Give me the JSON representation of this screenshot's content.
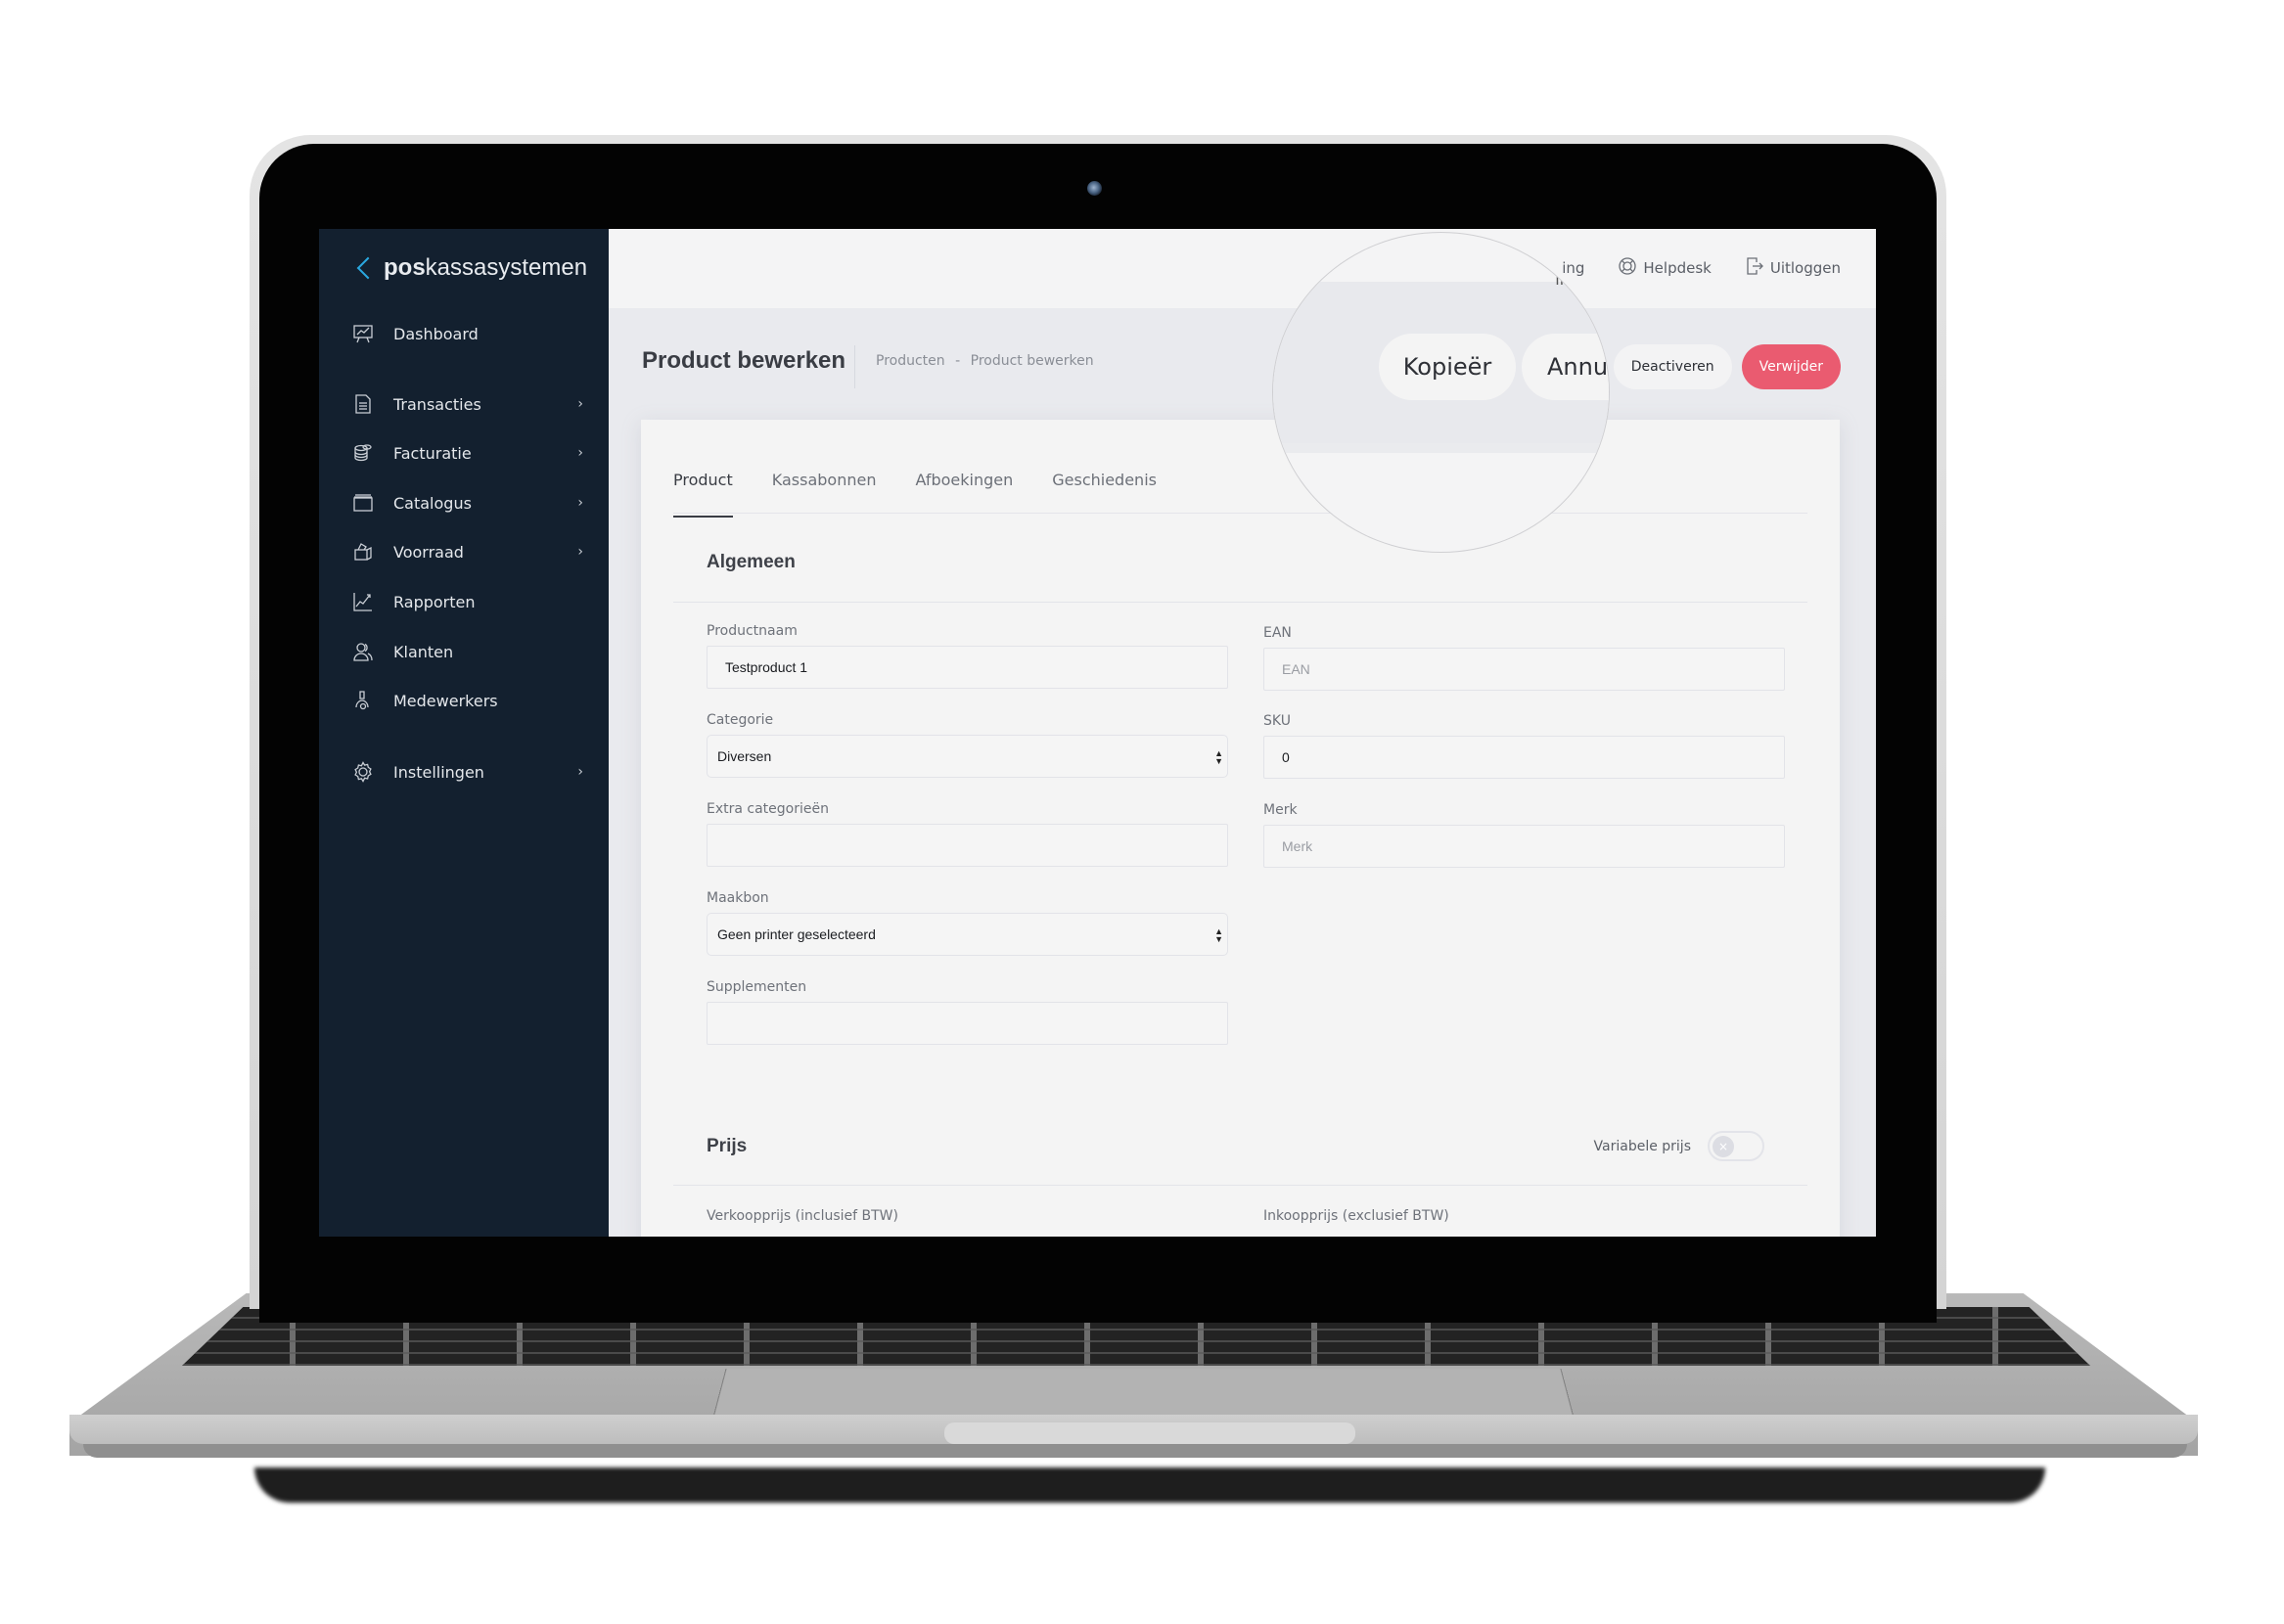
{
  "app": {
    "brand_bold": "pos",
    "brand_rest": "kassasystemen"
  },
  "sidebar": {
    "items": [
      {
        "label": "Dashboard",
        "icon": "presentation-chart-icon",
        "has_submenu": false
      },
      {
        "label": "Transacties",
        "icon": "document-icon",
        "has_submenu": true
      },
      {
        "label": "Facturatie",
        "icon": "coins-icon",
        "has_submenu": true
      },
      {
        "label": "Catalogus",
        "icon": "folder-icon",
        "has_submenu": true
      },
      {
        "label": "Voorraad",
        "icon": "box-icon",
        "has_submenu": true
      },
      {
        "label": "Rapporten",
        "icon": "line-chart-icon",
        "has_submenu": false
      },
      {
        "label": "Klanten",
        "icon": "users-icon",
        "has_submenu": false
      },
      {
        "label": "Medewerkers",
        "icon": "employee-icon",
        "has_submenu": false
      },
      {
        "label": "Instellingen",
        "icon": "gear-icon",
        "has_submenu": true
      }
    ],
    "chevron": "›"
  },
  "topbar": {
    "partial_link": "ing",
    "helpdesk": "Helpdesk",
    "logout": "Uitloggen"
  },
  "header": {
    "title": "Product bewerken",
    "breadcrumb": [
      "Producten",
      "-",
      "Product bewerken"
    ],
    "actions": {
      "copy": "Kopieër",
      "cancel_partial": "Annu",
      "deactivate": "Deactiveren",
      "delete": "Verwijder"
    }
  },
  "tabs": [
    "Product",
    "Kassabonnen",
    "Afboekingen",
    "Geschiedenis"
  ],
  "active_tab": "Product",
  "sections": {
    "general": {
      "title": "Algemeen",
      "fields": {
        "product_name": {
          "label": "Productnaam",
          "value": "Testproduct 1"
        },
        "category": {
          "label": "Categorie",
          "value": "Diversen"
        },
        "extra_categories": {
          "label": "Extra categorieën",
          "value": ""
        },
        "maakbon": {
          "label": "Maakbon",
          "value": "Geen printer geselecteerd"
        },
        "supplements": {
          "label": "Supplementen",
          "value": ""
        },
        "ean": {
          "label": "EAN",
          "value": "",
          "placeholder": "EAN"
        },
        "sku": {
          "label": "SKU",
          "value": "0"
        },
        "brand": {
          "label": "Merk",
          "value": "",
          "placeholder": "Merk"
        }
      }
    },
    "price": {
      "title": "Prijs",
      "variable_price_label": "Variabele prijs",
      "variable_price_enabled": false,
      "toggle_off_glyph": "×",
      "sale_price_label": "Verkoopprijs (inclusief BTW)",
      "purchase_price_label": "Inkoopprijs (exclusief BTW)"
    }
  },
  "colors": {
    "sidebar_bg": "#13202f",
    "brand_accent": "#2aa8e0",
    "danger": "#ea5b70",
    "page_bg": "#e9eaee",
    "card_bg": "#f4f4f4"
  }
}
